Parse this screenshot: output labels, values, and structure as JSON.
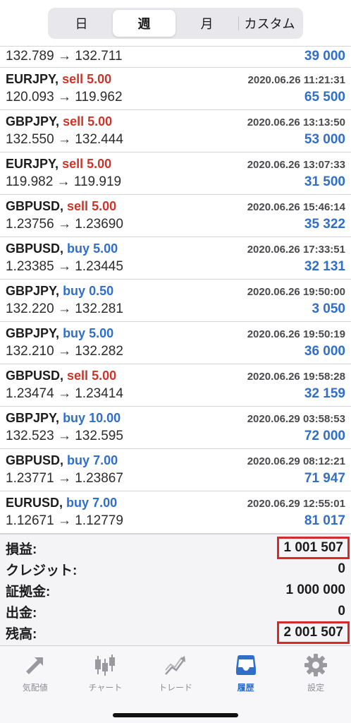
{
  "periods": {
    "day": "日",
    "week": "週",
    "month": "月",
    "custom": "カスタム"
  },
  "first_row": {
    "prices": "132.789 → 132.711",
    "profit": "39 000"
  },
  "deals": [
    {
      "symbol": "EURJPY,",
      "side": "sell",
      "volume": "5.00",
      "time": "2020.06.26 11:21:31",
      "prices": "120.093 → 119.962",
      "profit": "65 500"
    },
    {
      "symbol": "GBPJPY,",
      "side": "sell",
      "volume": "5.00",
      "time": "2020.06.26 13:13:50",
      "prices": "132.550 → 132.444",
      "profit": "53 000"
    },
    {
      "symbol": "EURJPY,",
      "side": "sell",
      "volume": "5.00",
      "time": "2020.06.26 13:07:33",
      "prices": "119.982 → 119.919",
      "profit": "31 500"
    },
    {
      "symbol": "GBPUSD,",
      "side": "sell",
      "volume": "5.00",
      "time": "2020.06.26 15:46:14",
      "prices": "1.23756 → 1.23690",
      "profit": "35 322"
    },
    {
      "symbol": "GBPUSD,",
      "side": "buy",
      "volume": "5.00",
      "time": "2020.06.26 17:33:51",
      "prices": "1.23385 → 1.23445",
      "profit": "32 131"
    },
    {
      "symbol": "GBPJPY,",
      "side": "buy",
      "volume": "0.50",
      "time": "2020.06.26 19:50:00",
      "prices": "132.220 → 132.281",
      "profit": "3 050"
    },
    {
      "symbol": "GBPJPY,",
      "side": "buy",
      "volume": "5.00",
      "time": "2020.06.26 19:50:19",
      "prices": "132.210 → 132.282",
      "profit": "36 000"
    },
    {
      "symbol": "GBPUSD,",
      "side": "sell",
      "volume": "5.00",
      "time": "2020.06.26 19:58:28",
      "prices": "1.23474 → 1.23414",
      "profit": "32 159"
    },
    {
      "symbol": "GBPJPY,",
      "side": "buy",
      "volume": "10.00",
      "time": "2020.06.29 03:58:53",
      "prices": "132.523 → 132.595",
      "profit": "72 000"
    },
    {
      "symbol": "GBPUSD,",
      "side": "buy",
      "volume": "7.00",
      "time": "2020.06.29 08:12:21",
      "prices": "1.23771 → 1.23867",
      "profit": "71 947"
    },
    {
      "symbol": "EURUSD,",
      "side": "buy",
      "volume": "7.00",
      "time": "2020.06.29 12:55:01",
      "prices": "1.12671 → 1.12779",
      "profit": "81 017"
    }
  ],
  "summary": {
    "profit_label": "損益:",
    "profit_value": "1 001 507",
    "credit_label": "クレジット:",
    "credit_value": "0",
    "margin_label": "証拠金:",
    "margin_value": "1 000 000",
    "withdraw_label": "出金:",
    "withdraw_value": "0",
    "balance_label": "残高:",
    "balance_value": "2 001 507"
  },
  "tabs": {
    "quotes": "気配値",
    "chart": "チャート",
    "trade": "トレード",
    "history": "履歴",
    "settings": "設定"
  },
  "colors": {
    "sell": "#c8362b",
    "buy": "#2f6fc9",
    "profit": "#2f6fc9",
    "highlight_box": "#d62a2a",
    "active_tab": "#2f6fc9",
    "inactive_tab": "#8e8e93"
  }
}
